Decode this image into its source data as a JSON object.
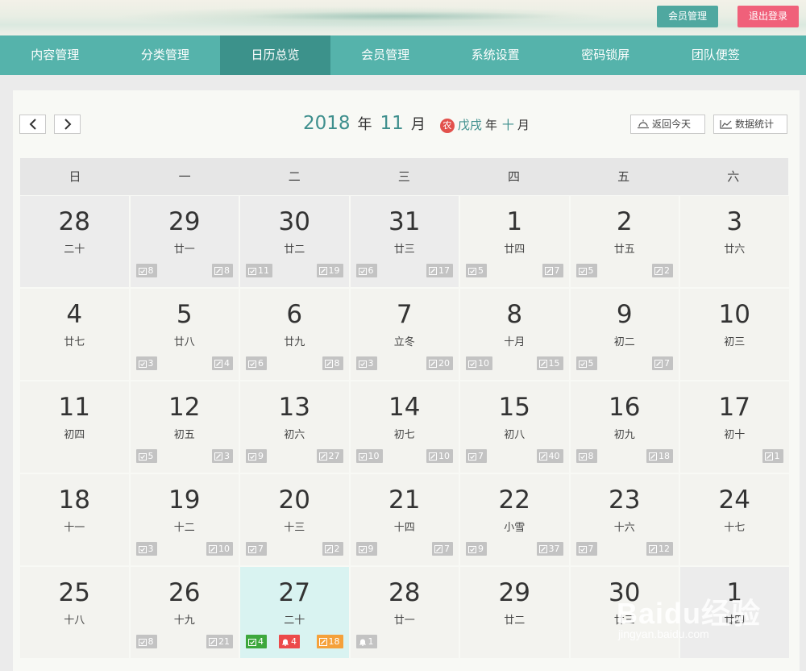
{
  "header": {
    "member_label": "会员管理",
    "logout_label": "退出登录"
  },
  "nav": {
    "items": [
      {
        "label": "内容管理"
      },
      {
        "label": "分类管理"
      },
      {
        "label": "日历总览",
        "active": true
      },
      {
        "label": "会员管理"
      },
      {
        "label": "系统设置"
      },
      {
        "label": "密码锁屏"
      },
      {
        "label": "团队便签"
      }
    ]
  },
  "toolbar": {
    "prev_icon": "chevron-left-icon",
    "next_icon": "chevron-right-icon",
    "year": "2018",
    "year_unit": "年",
    "month": "11",
    "month_unit": "月",
    "lunar_badge": "农",
    "lunar_year": "戊戌",
    "lunar_year_unit": "年",
    "lunar_month": "十",
    "lunar_month_unit": "月",
    "today_label": "返回今天",
    "stats_label": "数据统计"
  },
  "weekdays": [
    "日",
    "一",
    "二",
    "三",
    "四",
    "五",
    "六"
  ],
  "days": [
    {
      "day": "28",
      "lunar": "二十",
      "state": "dim"
    },
    {
      "day": "29",
      "lunar": "廿一",
      "state": "dim",
      "done": "8",
      "note": "8"
    },
    {
      "day": "30",
      "lunar": "廿二",
      "state": "dim",
      "done": "11",
      "note": "19"
    },
    {
      "day": "31",
      "lunar": "廿三",
      "state": "dim",
      "done": "6",
      "note": "17"
    },
    {
      "day": "1",
      "lunar": "廿四",
      "done": "5",
      "note": "7"
    },
    {
      "day": "2",
      "lunar": "廿五",
      "done": "5",
      "note": "2"
    },
    {
      "day": "3",
      "lunar": "廿六"
    },
    {
      "day": "4",
      "lunar": "廿七"
    },
    {
      "day": "5",
      "lunar": "廿八",
      "done": "3",
      "note": "4"
    },
    {
      "day": "6",
      "lunar": "廿九",
      "done": "6",
      "note": "8"
    },
    {
      "day": "7",
      "lunar": "立冬",
      "done": "3",
      "note": "20"
    },
    {
      "day": "8",
      "lunar": "十月",
      "done": "10",
      "note": "15"
    },
    {
      "day": "9",
      "lunar": "初二",
      "done": "5",
      "note": "7"
    },
    {
      "day": "10",
      "lunar": "初三"
    },
    {
      "day": "11",
      "lunar": "初四"
    },
    {
      "day": "12",
      "lunar": "初五",
      "done": "5",
      "note": "3"
    },
    {
      "day": "13",
      "lunar": "初六",
      "done": "9",
      "note": "27"
    },
    {
      "day": "14",
      "lunar": "初七",
      "done": "10",
      "note": "10"
    },
    {
      "day": "15",
      "lunar": "初八",
      "done": "7",
      "note": "40"
    },
    {
      "day": "16",
      "lunar": "初九",
      "done": "8",
      "note": "18"
    },
    {
      "day": "17",
      "lunar": "初十",
      "note": "1"
    },
    {
      "day": "18",
      "lunar": "十一"
    },
    {
      "day": "19",
      "lunar": "十二",
      "done": "3",
      "note": "10"
    },
    {
      "day": "20",
      "lunar": "十三",
      "done": "7",
      "note": "2"
    },
    {
      "day": "21",
      "lunar": "十四",
      "done": "9",
      "note": "7"
    },
    {
      "day": "22",
      "lunar": "小雪",
      "done": "9",
      "note": "37"
    },
    {
      "day": "23",
      "lunar": "十六",
      "done": "7",
      "note": "12"
    },
    {
      "day": "24",
      "lunar": "十七"
    },
    {
      "day": "25",
      "lunar": "十八"
    },
    {
      "day": "26",
      "lunar": "十九",
      "done": "8",
      "note": "21"
    },
    {
      "day": "27",
      "lunar": "二十",
      "state": "today",
      "done": "4",
      "alarm": "4",
      "note": "18"
    },
    {
      "day": "28",
      "lunar": "廿一",
      "bell": "1"
    },
    {
      "day": "29",
      "lunar": "廿二"
    },
    {
      "day": "30",
      "lunar": "廿三"
    },
    {
      "day": "1",
      "lunar": "廿四",
      "state": "next"
    }
  ],
  "watermark": {
    "text": "Baidu经验",
    "url": "jingyan.baidu.com"
  },
  "colors": {
    "nav_bg": "#55b3ab",
    "nav_active": "#3c928b",
    "accent_teal": "#3e8f8d",
    "logout": "#f0607a",
    "today_bg": "#d9f3f1",
    "badge_gray": "#c3c3c3",
    "badge_green": "#3da83d",
    "badge_red": "#ec4a4a",
    "badge_orange": "#f5a13b"
  }
}
